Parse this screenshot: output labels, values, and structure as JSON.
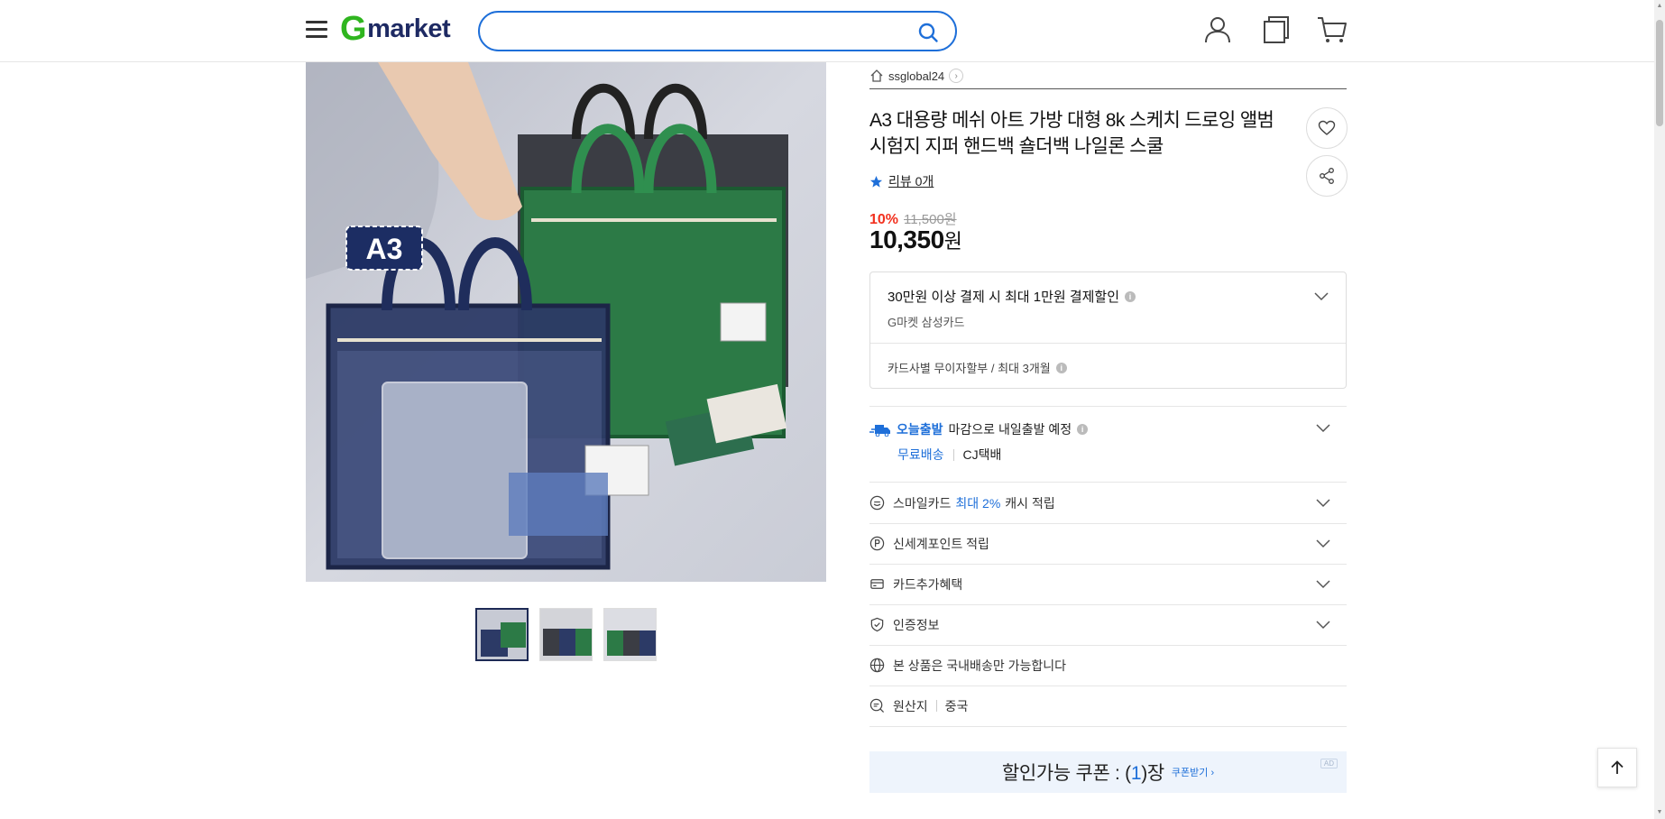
{
  "header": {
    "logo_g": "G",
    "logo_rest": "market",
    "search_placeholder": "",
    "icons": [
      "menu-icon",
      "search-icon",
      "user-icon",
      "recent-view-icon",
      "cart-icon"
    ]
  },
  "gallery": {
    "badge": "A3",
    "thumb_count": 3
  },
  "product": {
    "seller": "ssglobal24",
    "title": "A3 대용량 메쉬 아트 가방 대형 8k 스케치 드로잉 앨범 시험지 지퍼 핸드백 숄더백 나일론 스쿨",
    "review": "리뷰 0개",
    "discount": "10%",
    "original_price": "11,500원",
    "price": "10,350",
    "price_unit": "원"
  },
  "card_benefit": {
    "main": "30만원 이상 결제 시 최대 1만원 결제할인",
    "sub": "G마켓 삼성카드",
    "installment": "카드사별 무이자할부 / 최대 3개월"
  },
  "shipping": {
    "today": "오늘출발",
    "deadline": "마감으로 내일출발 예정",
    "free": "무료배송",
    "courier": "CJ택배"
  },
  "benefits": {
    "smilecard_prefix": "스마일카드",
    "smilecard_highlight": "최대 2%",
    "smilecard_suffix": "캐시 적립",
    "ssg_point": "신세계포인트 적립",
    "card_extra": "카드추가혜택",
    "certification": "인증정보",
    "domestic_only": "본 상품은 국내배송만 가능합니다",
    "origin_label": "원산지",
    "origin_value": "중국"
  },
  "coupon": {
    "prefix": "할인가능 쿠폰 : (",
    "count": "1",
    "suffix": ")장",
    "get": "쿠폰받기 ›",
    "ad": "AD"
  },
  "colors": {
    "brand_green": "#2fb51f",
    "brand_navy": "#1e2a63",
    "accent_blue": "#1e6fd9",
    "discount_red": "#f2311f"
  }
}
